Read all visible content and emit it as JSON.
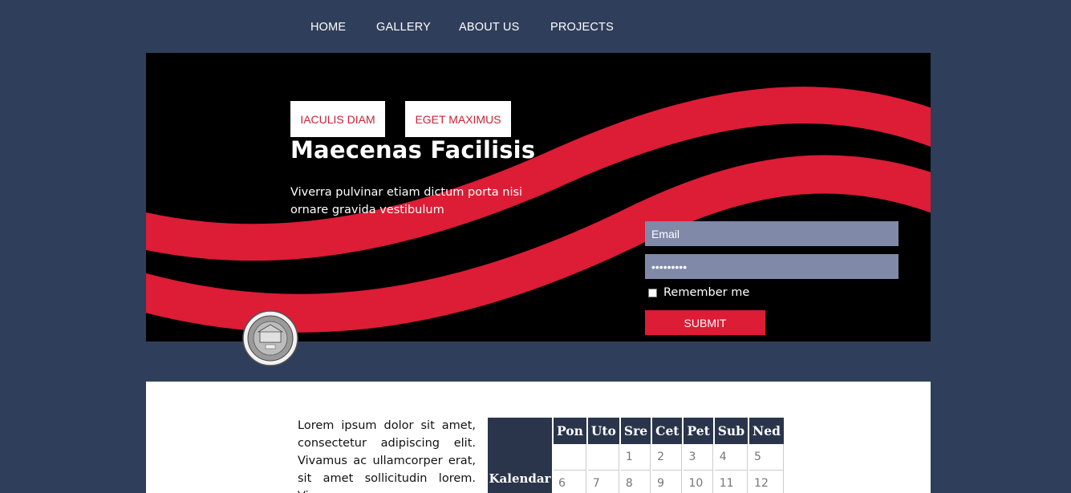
{
  "nav": {
    "items": [
      "HOME",
      "GALLERY",
      "ABOUT US",
      "PROJECTS"
    ]
  },
  "hero": {
    "buttons": [
      "IACULIS DIAM",
      "EGET MAXIMUS"
    ],
    "title": "Maecenas Facilisis",
    "subtitle": "Viverra pulvinar etiam dictum porta nisi ornare gravida vestibulum",
    "accent_color": "#dd1c35"
  },
  "login": {
    "email_placeholder": "Email",
    "password_value": "•••••••••",
    "remember_label": "Remember me",
    "remember_checked": false,
    "submit_label": "SUBMIT"
  },
  "content": {
    "text": "Lorem ipsum dolor sit amet, consectetur adipiscing elit. Vivamus ac ullamcorper erat, sit amet sollicitudin lorem. Vivamus"
  },
  "calendar": {
    "label": "Kalendar",
    "days": [
      "Pon",
      "Uto",
      "Sre",
      "Cet",
      "Pet",
      "Sub",
      "Ned"
    ],
    "weeks": [
      [
        "",
        "",
        "1",
        "2",
        "3",
        "4",
        "5"
      ],
      [
        "6",
        "7",
        "8",
        "9",
        "10",
        "11",
        "12"
      ]
    ]
  },
  "seal": {
    "icon": "university-seal-icon"
  }
}
